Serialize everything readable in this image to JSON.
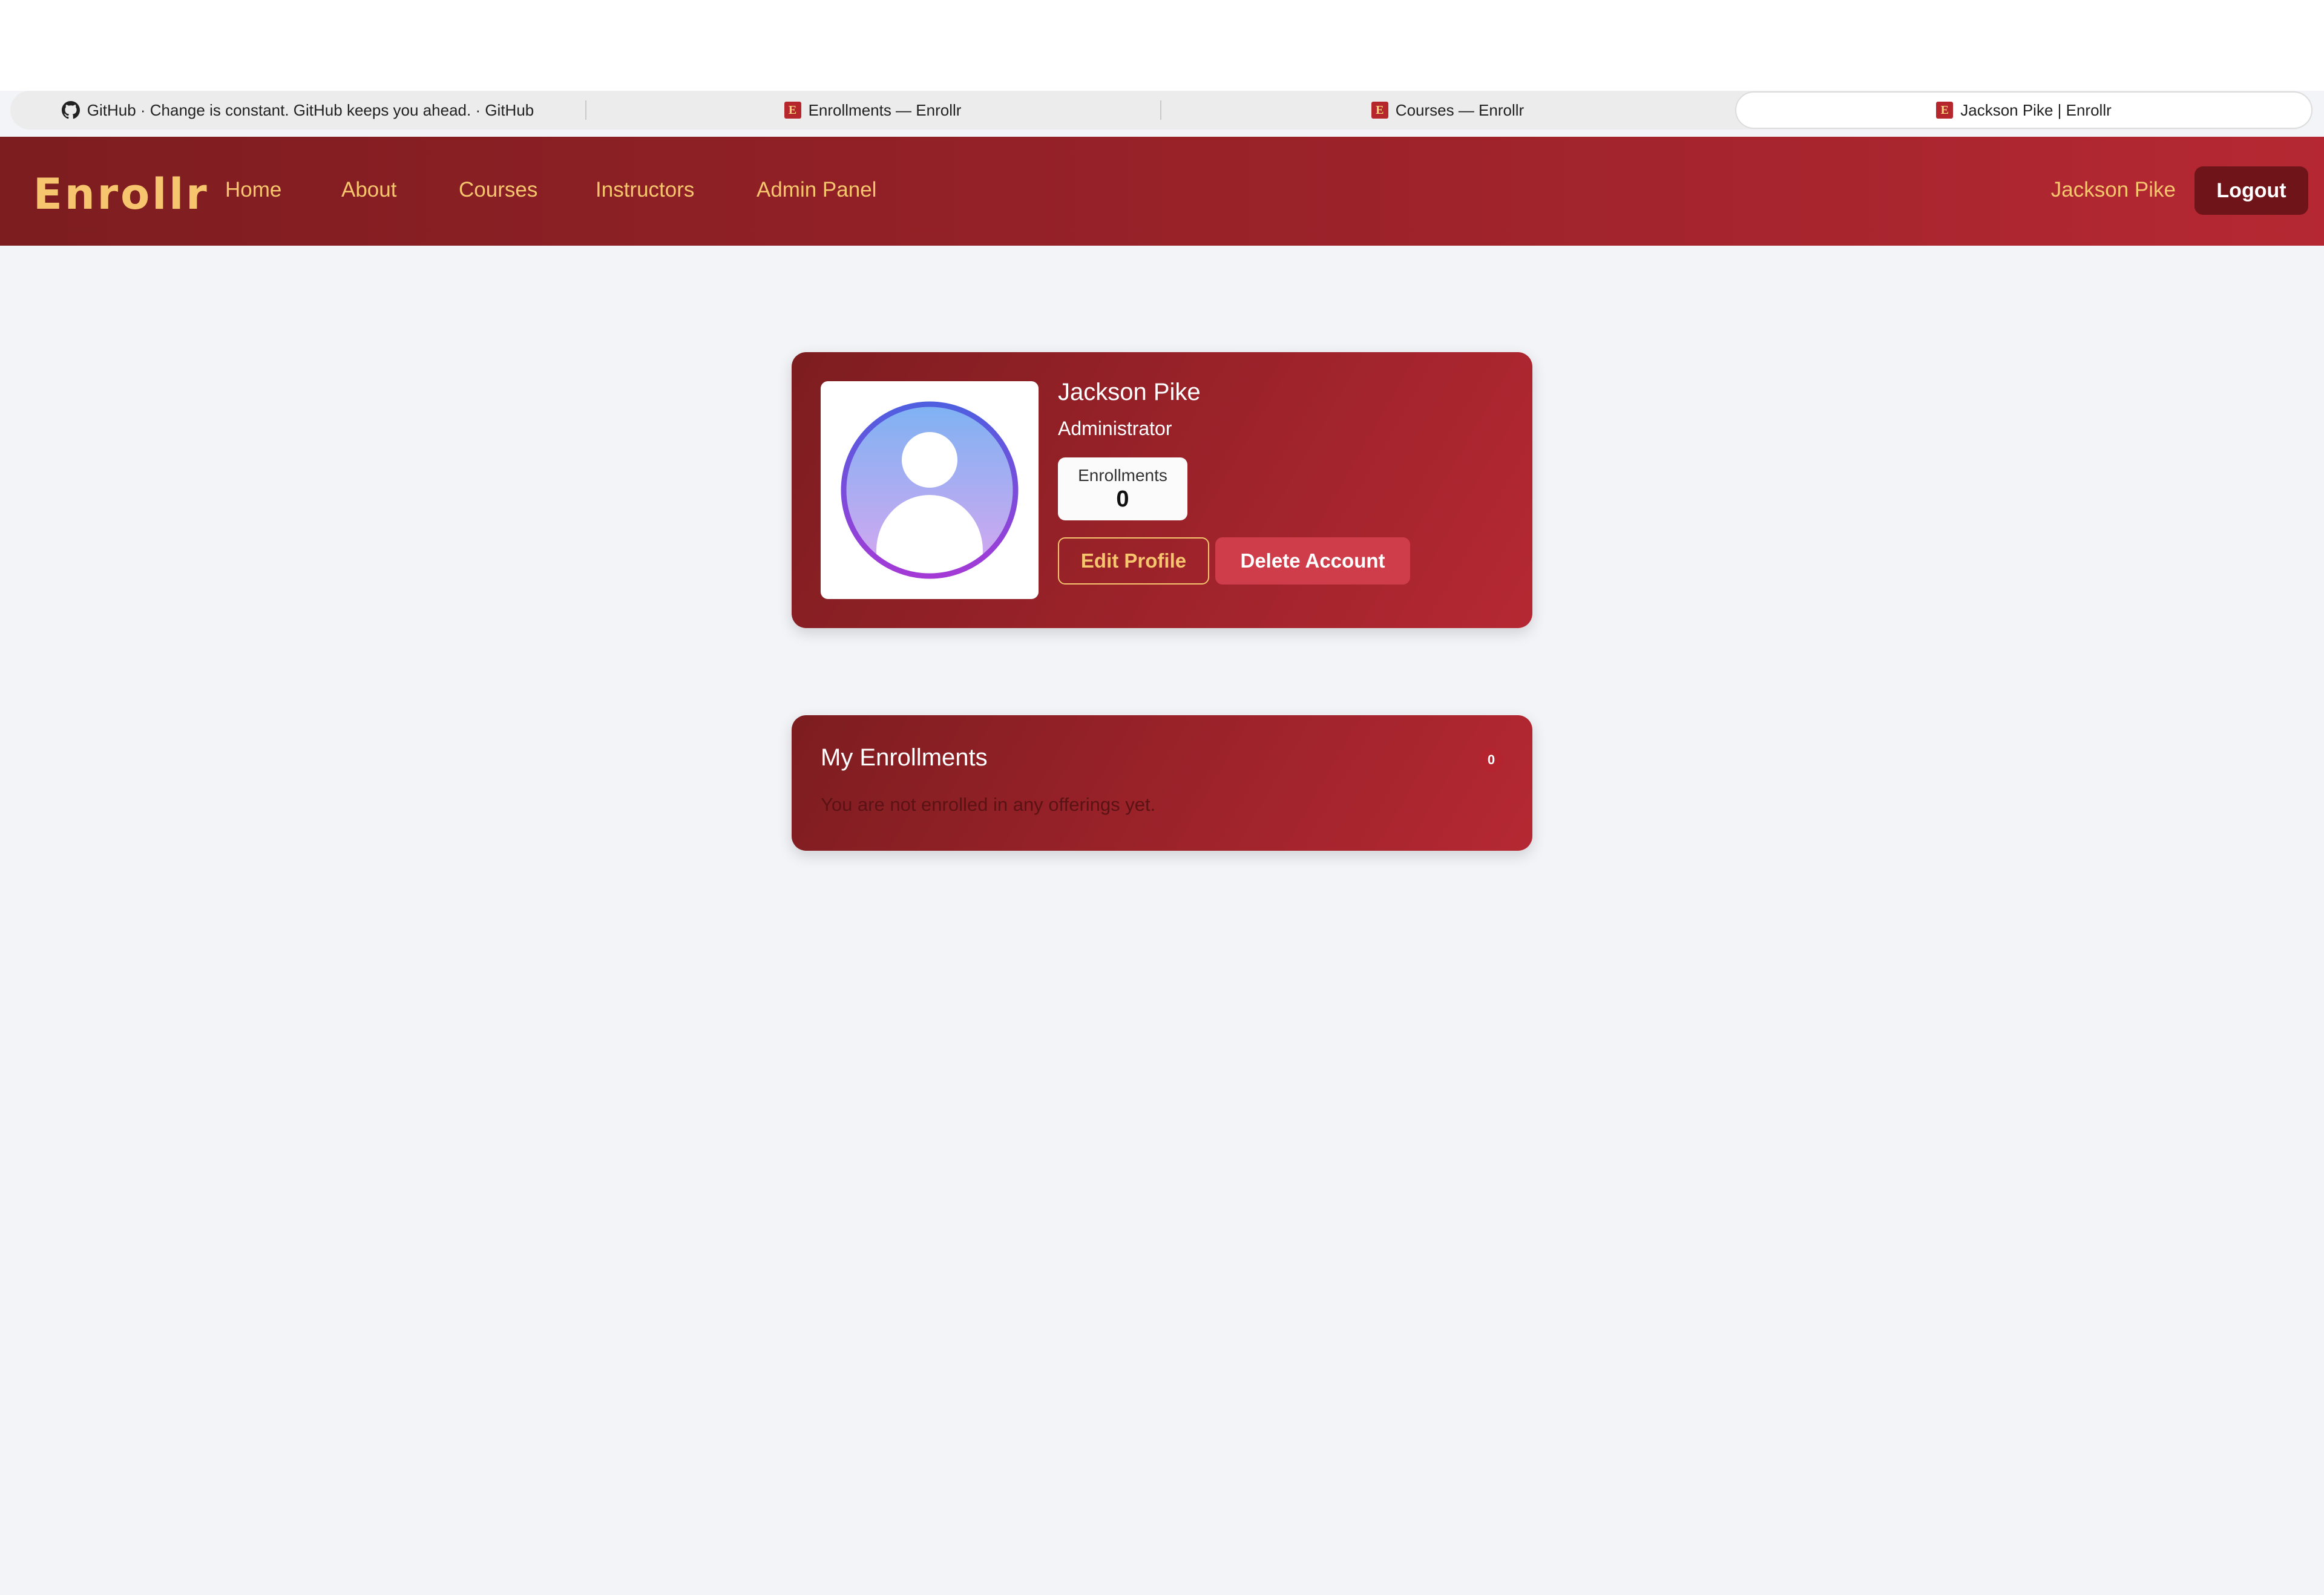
{
  "browser": {
    "tabs": [
      {
        "title": "GitHub · Change is constant. GitHub keeps you ahead. · GitHub",
        "icon": "github-icon",
        "active": false
      },
      {
        "title": "Enrollments — Enrollr",
        "icon": "enrollr-favicon",
        "active": false
      },
      {
        "title": "Courses — Enrollr",
        "icon": "enrollr-favicon",
        "active": false
      },
      {
        "title": "Jackson Pike | Enrollr",
        "icon": "enrollr-favicon",
        "active": true
      }
    ],
    "favicon_letter": "E"
  },
  "navbar": {
    "brand": "Enrollr",
    "links": [
      "Home",
      "About",
      "Courses",
      "Instructors",
      "Admin Panel"
    ],
    "user_name": "Jackson Pike",
    "logout_label": "Logout",
    "colors": {
      "accent": "#f6c56e",
      "primary": "#9a2229",
      "logout_bg": "#6f1418"
    }
  },
  "profile": {
    "name": "Jackson Pike",
    "role": "Administrator",
    "stat_label": "Enrollments",
    "stat_value": "0",
    "edit_label": "Edit Profile",
    "delete_label": "Delete Account",
    "avatar_icon": "user-avatar-icon"
  },
  "enrollments": {
    "title": "My Enrollments",
    "count": "0",
    "empty_message": "You are not enrolled in any offerings yet."
  }
}
